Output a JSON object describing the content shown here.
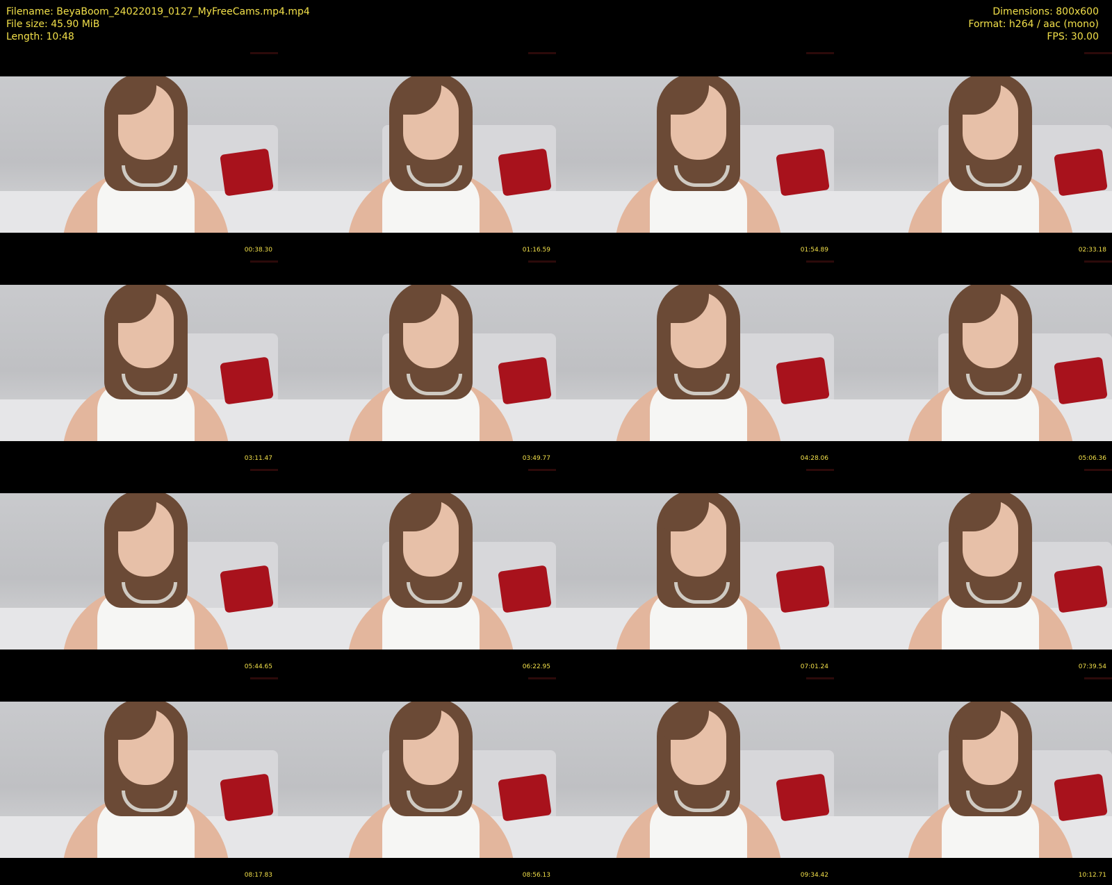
{
  "info": {
    "filename": "Filename: BeyaBoom_24022019_0127_MyFreeCams.mp4.mp4",
    "filesize": "File size: 45.90 MiB",
    "length": "Length: 10:48",
    "dimensions": "Dimensions: 800x600",
    "format": "Format: h264 / aac (mono)",
    "fps": "FPS: 30.00"
  },
  "thumbnails": [
    {
      "timestamp": "00:38.30"
    },
    {
      "timestamp": "01:16.59"
    },
    {
      "timestamp": "01:54.89"
    },
    {
      "timestamp": "02:33.18"
    },
    {
      "timestamp": "03:11.47"
    },
    {
      "timestamp": "03:49.77"
    },
    {
      "timestamp": "04:28.06"
    },
    {
      "timestamp": "05:06.36"
    },
    {
      "timestamp": "05:44.65"
    },
    {
      "timestamp": "06:22.95"
    },
    {
      "timestamp": "07:01.24"
    },
    {
      "timestamp": "07:39.54"
    },
    {
      "timestamp": "08:17.83"
    },
    {
      "timestamp": "08:56.13"
    },
    {
      "timestamp": "09:34.42"
    },
    {
      "timestamp": "10:12.71"
    }
  ]
}
